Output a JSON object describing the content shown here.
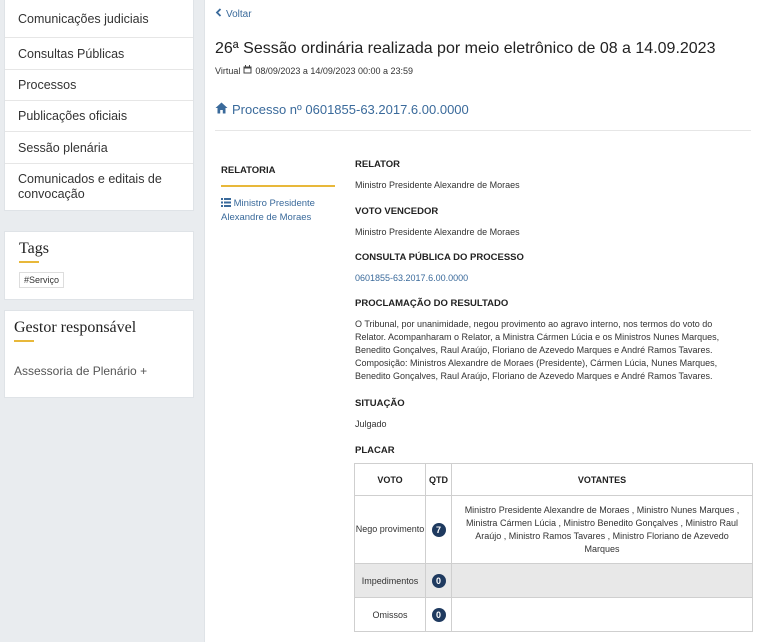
{
  "sidebar": {
    "nav_items": [
      {
        "label": "Comunicações judiciais"
      },
      {
        "label": "Consultas Públicas"
      },
      {
        "label": "Processos"
      },
      {
        "label": "Publicações oficiais"
      },
      {
        "label": "Sessão plenária"
      },
      {
        "label": "Comunicados e editais de convocação"
      }
    ],
    "tags": {
      "title": "Tags",
      "chips": [
        "#Serviço"
      ]
    },
    "gestor": {
      "title": "Gestor responsável",
      "item": "Assessoria de Plenário +"
    }
  },
  "main": {
    "back_label": "Voltar",
    "title": "26ª Sessão ordinária realizada por meio eletrônico de 08 a 14.09.2023",
    "mode": "Virtual",
    "date_range": "08/09/2023 a 14/09/2023 00:00 a 23:59",
    "processo": "Processo nº 0601855-63.2017.6.00.0000",
    "relatoria_tab": "RELATORIA",
    "relatoria_link": "Ministro Presidente Alexandre de Moraes",
    "fields": {
      "relator_h": "RELATOR",
      "relator_v": "Ministro Presidente Alexandre de Moraes",
      "voto_h": "VOTO VENCEDOR",
      "voto_v": "Ministro Presidente Alexandre de Moraes",
      "consulta_h": "CONSULTA PÚBLICA DO PROCESSO",
      "consulta_v": "0601855-63.2017.6.00.0000",
      "proclamacao_h": "PROCLAMAÇÃO DO RESULTADO",
      "proclamacao_v": "O Tribunal, por unanimidade, negou provimento ao agravo interno, nos termos do voto do Relator. Acompanharam o Relator, a Ministra Cármen Lúcia e os Ministros Nunes Marques, Benedito Gonçalves, Raul Araújo, Floriano de Azevedo Marques e André Ramos Tavares. Composição: Ministros Alexandre de Moraes (Presidente), Cármen Lúcia, Nunes Marques, Benedito Gonçalves, Raul Araújo, Floriano de Azevedo Marques e André Ramos Tavares.",
      "situacao_h": "SITUAÇÃO",
      "situacao_v": "Julgado",
      "placar_h": "PLACAR"
    },
    "placar": {
      "headers": {
        "voto": "VOTO",
        "qtd": "QTD",
        "votantes": "VOTANTES"
      },
      "rows": [
        {
          "voto": "Nego provimento",
          "qtd": "7",
          "votantes": "Ministro Presidente Alexandre de Moraes , Ministro Nunes Marques , Ministra Cármen Lúcia , Ministro Benedito Gonçalves , Ministro Raul Araújo , Ministro Ramos Tavares , Ministro Floriano de Azevedo Marques"
        },
        {
          "voto": "Impedimentos",
          "qtd": "0",
          "votantes": ""
        },
        {
          "voto": "Omissos",
          "qtd": "0",
          "votantes": ""
        }
      ]
    }
  },
  "colors": {
    "link": "#3a6a9b",
    "accent": "#e8b83a",
    "badge": "#1f3a5f"
  }
}
